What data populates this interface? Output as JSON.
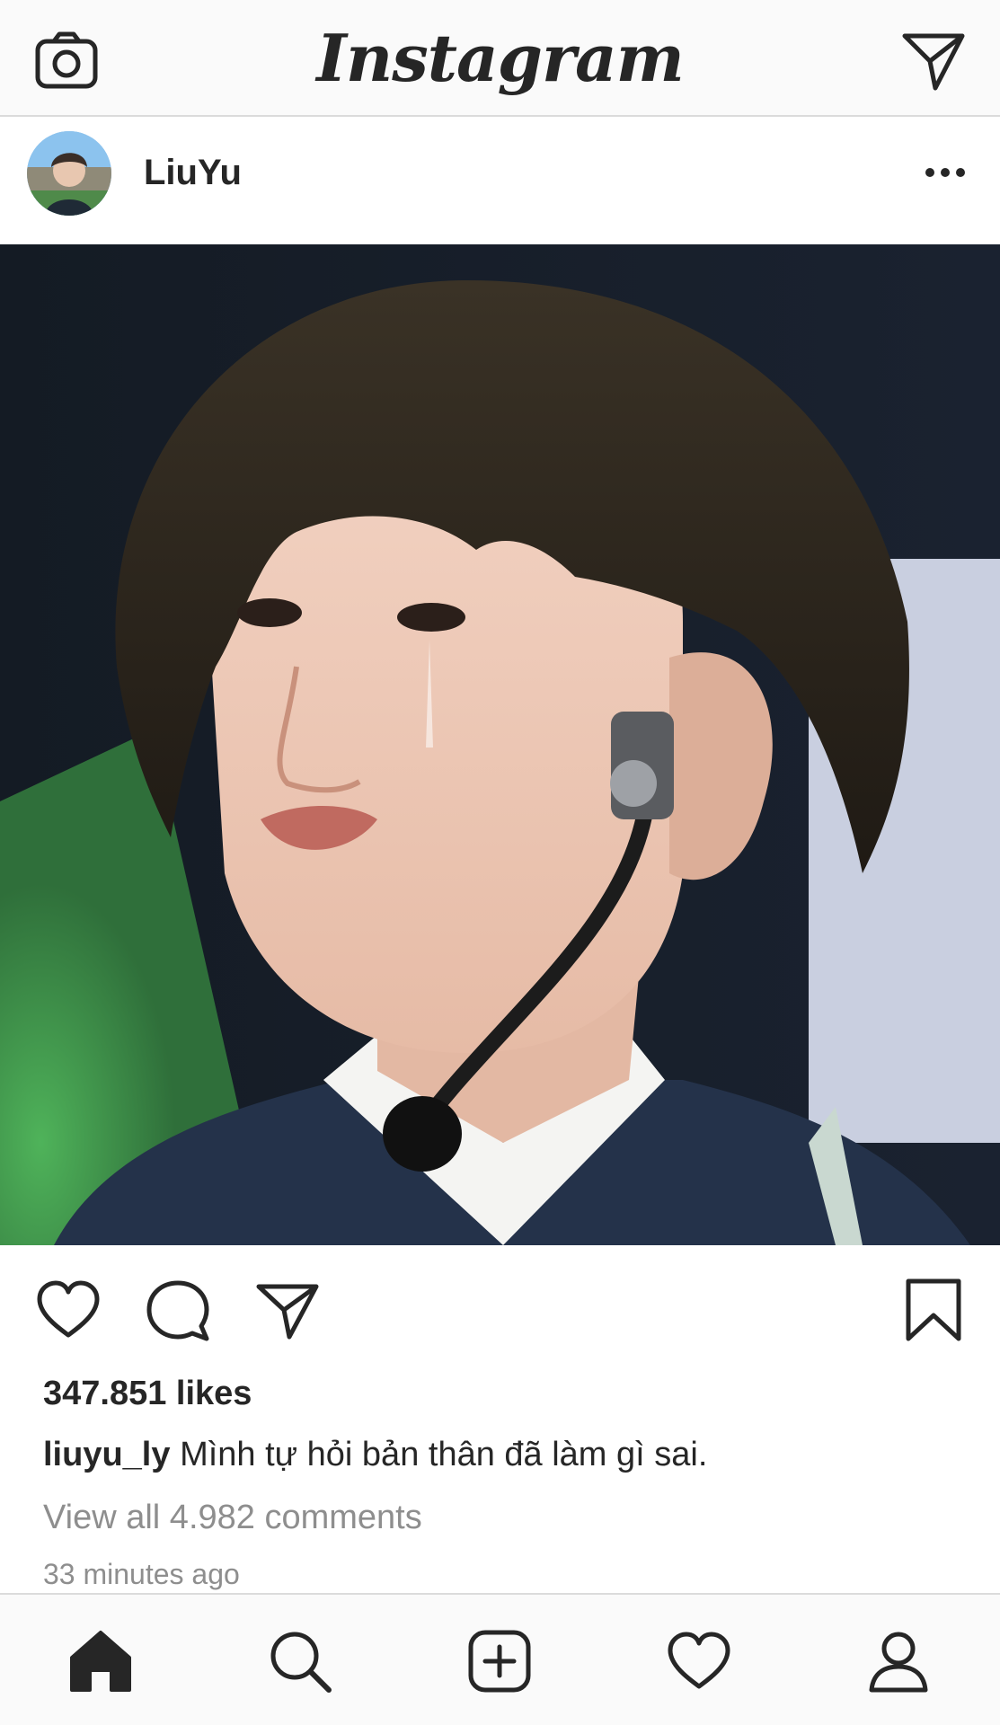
{
  "topbar": {
    "logo_text": "Instagram",
    "icons": {
      "left": "camera-icon",
      "right": "direct-message-icon"
    }
  },
  "post": {
    "header": {
      "username": "LiuYu",
      "avatar": "avatar-photo",
      "more_icon": "more-options-icon"
    },
    "image": {
      "description_icon": "post-photo"
    },
    "actions": {
      "icons": [
        "heart-icon",
        "comment-icon",
        "share-icon",
        "bookmark-icon"
      ]
    },
    "likes_text": "347.851 likes",
    "caption": {
      "user": "liuyu_ly",
      "text": "Mình tự hỏi bản thân đã làm gì sai."
    },
    "view_comments_text": "View all 4.982 comments",
    "timestamp": "33 minutes ago"
  },
  "bottom_nav": {
    "icons": [
      "home-icon",
      "search-icon",
      "new-post-icon",
      "activity-icon",
      "profile-icon"
    ],
    "active": "home-icon"
  },
  "colors": {
    "text_primary": "#262626",
    "text_secondary": "#8e8e8e",
    "bar_background": "#fafafa",
    "divider": "#dbdbdb"
  }
}
